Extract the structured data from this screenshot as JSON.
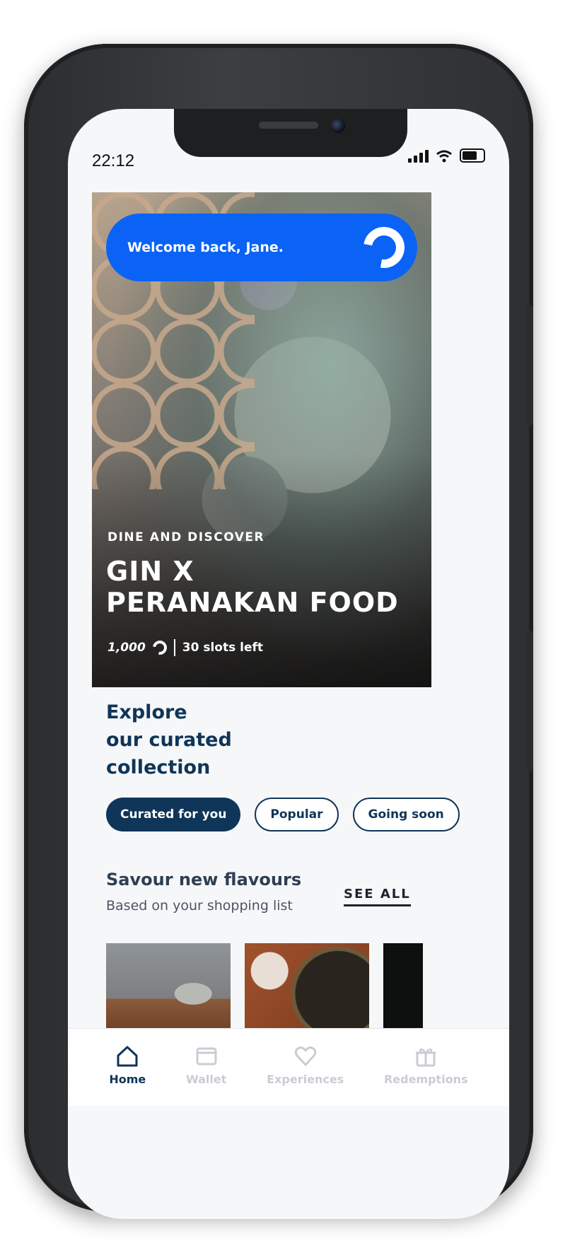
{
  "status_bar": {
    "time": "22:12"
  },
  "header": {
    "welcome": "Welcome back, Jane."
  },
  "hero": {
    "kicker": "DINE AND DISCOVER",
    "title_line1": "GIN X",
    "title_line2": "PERANAKAN FOOD",
    "points": "1,000",
    "slots": "30 slots left"
  },
  "explore": {
    "title_line1": "Explore",
    "title_line2": "our curated",
    "title_line3": "collection",
    "chips": [
      {
        "label": "Curated for you",
        "active": true
      },
      {
        "label": "Popular",
        "active": false
      },
      {
        "label": "Going soon",
        "active": false
      }
    ]
  },
  "section": {
    "title": "Savour new flavours",
    "subtitle": "Based on your shopping list",
    "see_all": "SEE ALL"
  },
  "bottom_nav": [
    {
      "label": "Home",
      "icon": "home-icon",
      "active": true
    },
    {
      "label": "Wallet",
      "icon": "wallet-icon",
      "active": false
    },
    {
      "label": "Experiences",
      "icon": "heart-icon",
      "active": false
    },
    {
      "label": "Redemptions",
      "icon": "gift-icon",
      "active": false
    }
  ],
  "colors": {
    "brand_blue": "#0b63f5",
    "navy": "#0f3558",
    "inactive_nav": "#c9cdd3"
  }
}
